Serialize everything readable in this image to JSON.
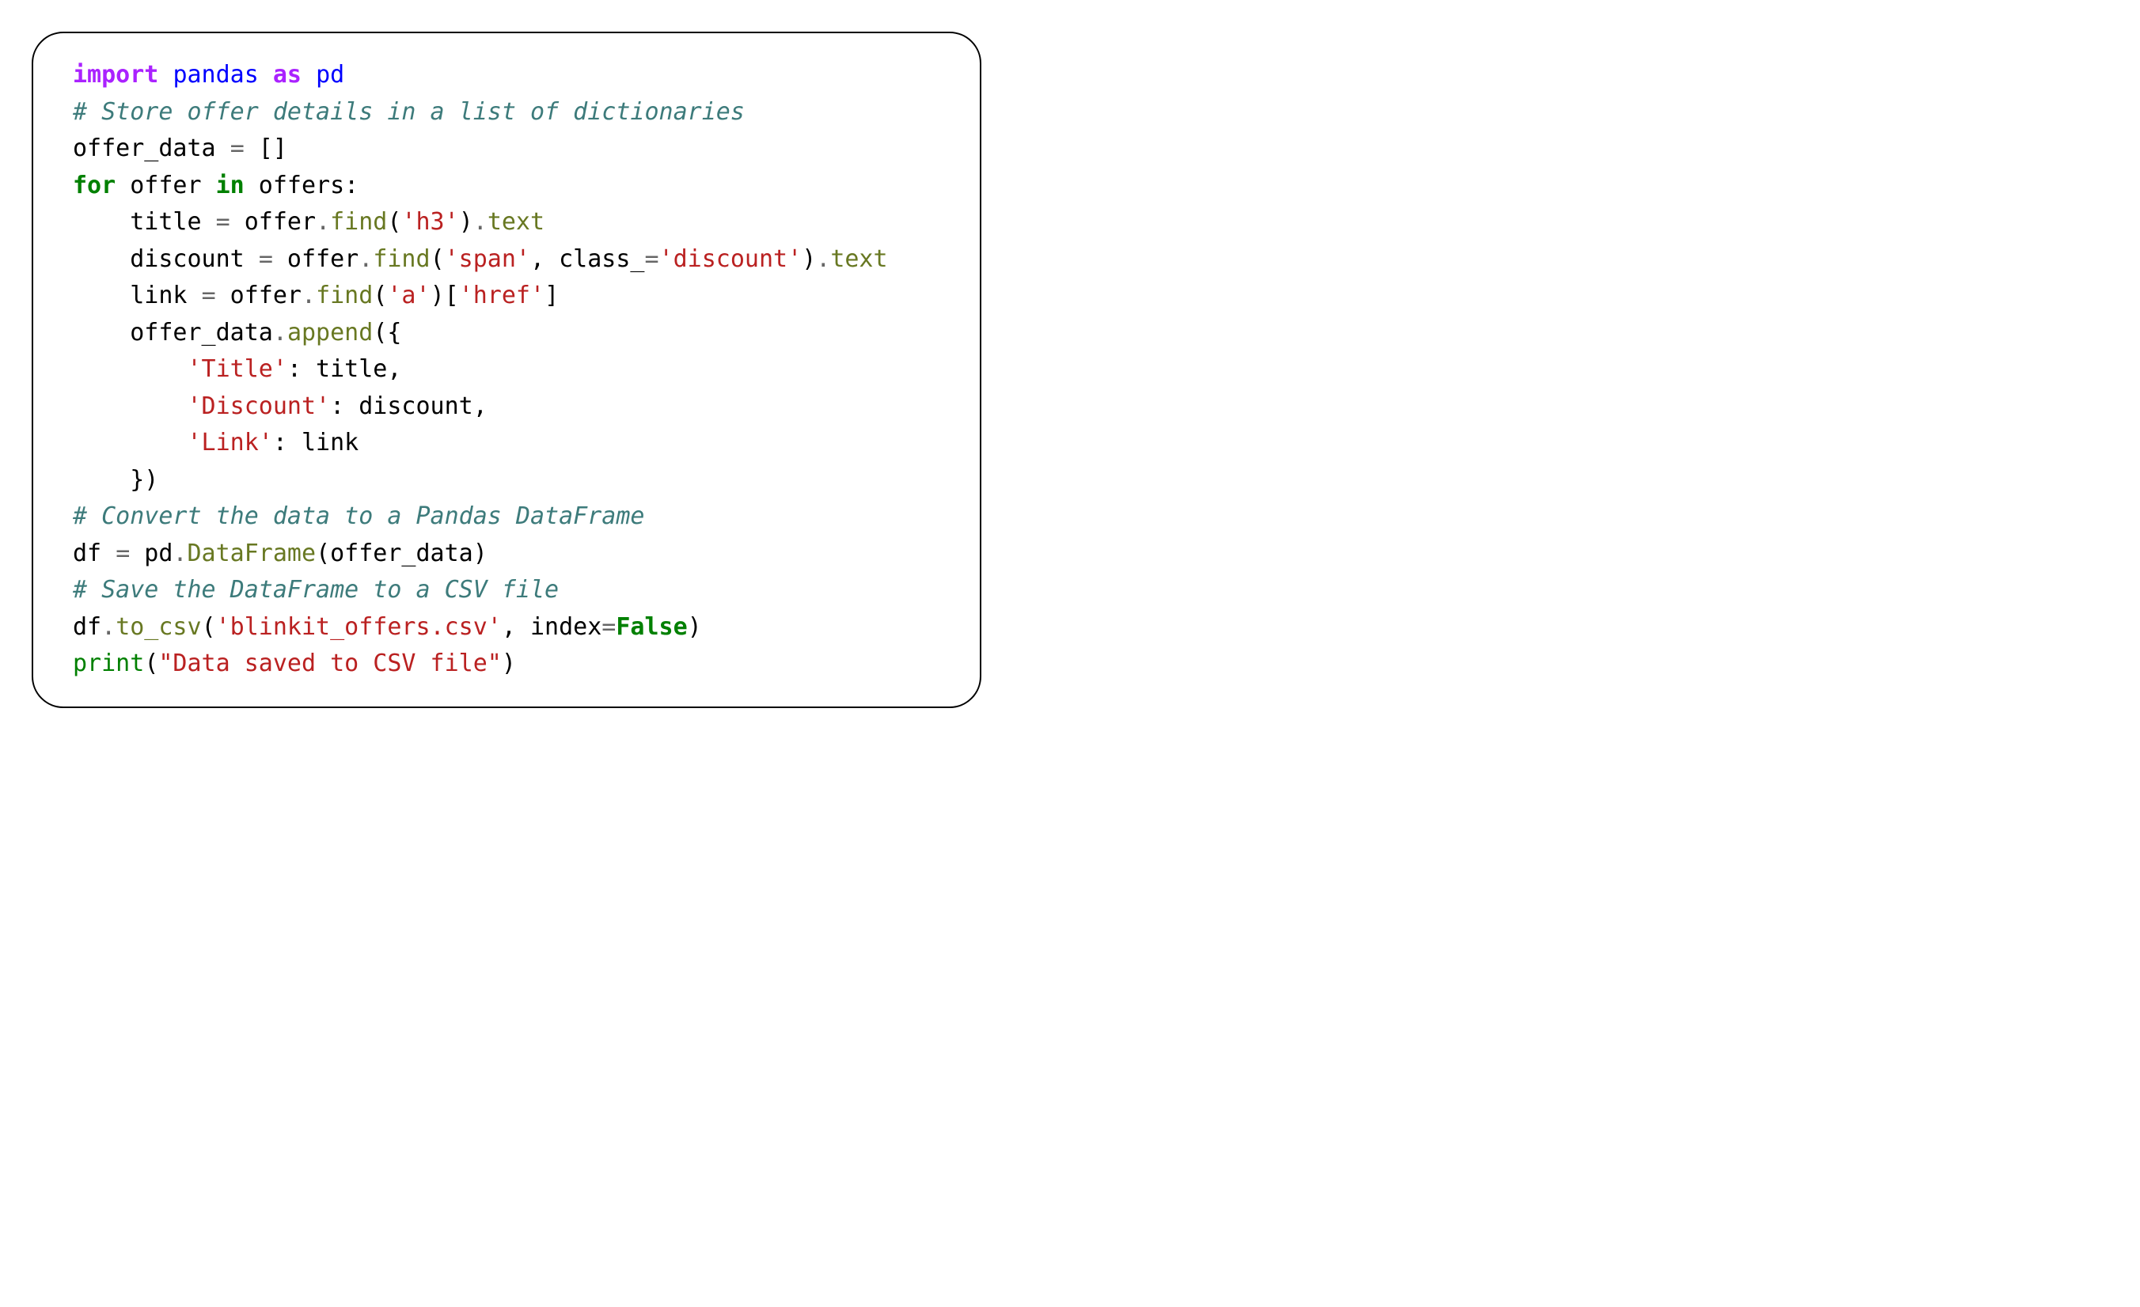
{
  "code": {
    "tokens": [
      [
        {
          "t": "import",
          "c": "kw-import"
        },
        {
          "t": " ",
          "c": "txt"
        },
        {
          "t": "pandas",
          "c": "nm"
        },
        {
          "t": " ",
          "c": "txt"
        },
        {
          "t": "as",
          "c": "kw-import"
        },
        {
          "t": " ",
          "c": "txt"
        },
        {
          "t": "pd",
          "c": "nm"
        }
      ],
      [
        {
          "t": "# Store offer details in a list of dictionaries",
          "c": "cmt"
        }
      ],
      [
        {
          "t": "offer_data ",
          "c": "txt"
        },
        {
          "t": "=",
          "c": "op"
        },
        {
          "t": " []",
          "c": "txt"
        }
      ],
      [
        {
          "t": "for",
          "c": "kw-flow"
        },
        {
          "t": " offer ",
          "c": "txt"
        },
        {
          "t": "in",
          "c": "kw-flow"
        },
        {
          "t": " offers:",
          "c": "txt"
        }
      ],
      [
        {
          "t": "    title ",
          "c": "txt"
        },
        {
          "t": "=",
          "c": "op"
        },
        {
          "t": " offer",
          "c": "txt"
        },
        {
          "t": ".",
          "c": "op"
        },
        {
          "t": "find",
          "c": "fn"
        },
        {
          "t": "(",
          "c": "txt"
        },
        {
          "t": "'h3'",
          "c": "str"
        },
        {
          "t": ")",
          "c": "txt"
        },
        {
          "t": ".",
          "c": "op"
        },
        {
          "t": "text",
          "c": "fn"
        }
      ],
      [
        {
          "t": "    discount ",
          "c": "txt"
        },
        {
          "t": "=",
          "c": "op"
        },
        {
          "t": " offer",
          "c": "txt"
        },
        {
          "t": ".",
          "c": "op"
        },
        {
          "t": "find",
          "c": "fn"
        },
        {
          "t": "(",
          "c": "txt"
        },
        {
          "t": "'span'",
          "c": "str"
        },
        {
          "t": ", class_",
          "c": "txt"
        },
        {
          "t": "=",
          "c": "op"
        },
        {
          "t": "'discount'",
          "c": "str"
        },
        {
          "t": ")",
          "c": "txt"
        },
        {
          "t": ".",
          "c": "op"
        },
        {
          "t": "text",
          "c": "fn"
        }
      ],
      [
        {
          "t": "    link ",
          "c": "txt"
        },
        {
          "t": "=",
          "c": "op"
        },
        {
          "t": " offer",
          "c": "txt"
        },
        {
          "t": ".",
          "c": "op"
        },
        {
          "t": "find",
          "c": "fn"
        },
        {
          "t": "(",
          "c": "txt"
        },
        {
          "t": "'a'",
          "c": "str"
        },
        {
          "t": ")[",
          "c": "txt"
        },
        {
          "t": "'href'",
          "c": "str"
        },
        {
          "t": "]",
          "c": "txt"
        }
      ],
      [
        {
          "t": "    offer_data",
          "c": "txt"
        },
        {
          "t": ".",
          "c": "op"
        },
        {
          "t": "append",
          "c": "fn"
        },
        {
          "t": "({",
          "c": "txt"
        }
      ],
      [
        {
          "t": "        ",
          "c": "txt"
        },
        {
          "t": "'Title'",
          "c": "str"
        },
        {
          "t": ": title,",
          "c": "txt"
        }
      ],
      [
        {
          "t": "        ",
          "c": "txt"
        },
        {
          "t": "'Discount'",
          "c": "str"
        },
        {
          "t": ": discount,",
          "c": "txt"
        }
      ],
      [
        {
          "t": "        ",
          "c": "txt"
        },
        {
          "t": "'Link'",
          "c": "str"
        },
        {
          "t": ": link",
          "c": "txt"
        }
      ],
      [
        {
          "t": "    })",
          "c": "txt"
        }
      ],
      [
        {
          "t": "# Convert the data to a Pandas DataFrame",
          "c": "cmt"
        }
      ],
      [
        {
          "t": "df ",
          "c": "txt"
        },
        {
          "t": "=",
          "c": "op"
        },
        {
          "t": " pd",
          "c": "txt"
        },
        {
          "t": ".",
          "c": "op"
        },
        {
          "t": "DataFrame",
          "c": "fn"
        },
        {
          "t": "(offer_data)",
          "c": "txt"
        }
      ],
      [
        {
          "t": "# Save the DataFrame to a CSV file",
          "c": "cmt"
        }
      ],
      [
        {
          "t": "df",
          "c": "txt"
        },
        {
          "t": ".",
          "c": "op"
        },
        {
          "t": "to_csv",
          "c": "fn"
        },
        {
          "t": "(",
          "c": "txt"
        },
        {
          "t": "'blinkit_offers.csv'",
          "c": "str"
        },
        {
          "t": ", index",
          "c": "txt"
        },
        {
          "t": "=",
          "c": "op"
        },
        {
          "t": "False",
          "c": "kw-const"
        },
        {
          "t": ")",
          "c": "txt"
        }
      ],
      [
        {
          "t": "print",
          "c": "builtin"
        },
        {
          "t": "(",
          "c": "txt"
        },
        {
          "t": "\"Data saved to CSV file\"",
          "c": "str"
        },
        {
          "t": ")",
          "c": "txt"
        }
      ]
    ]
  }
}
